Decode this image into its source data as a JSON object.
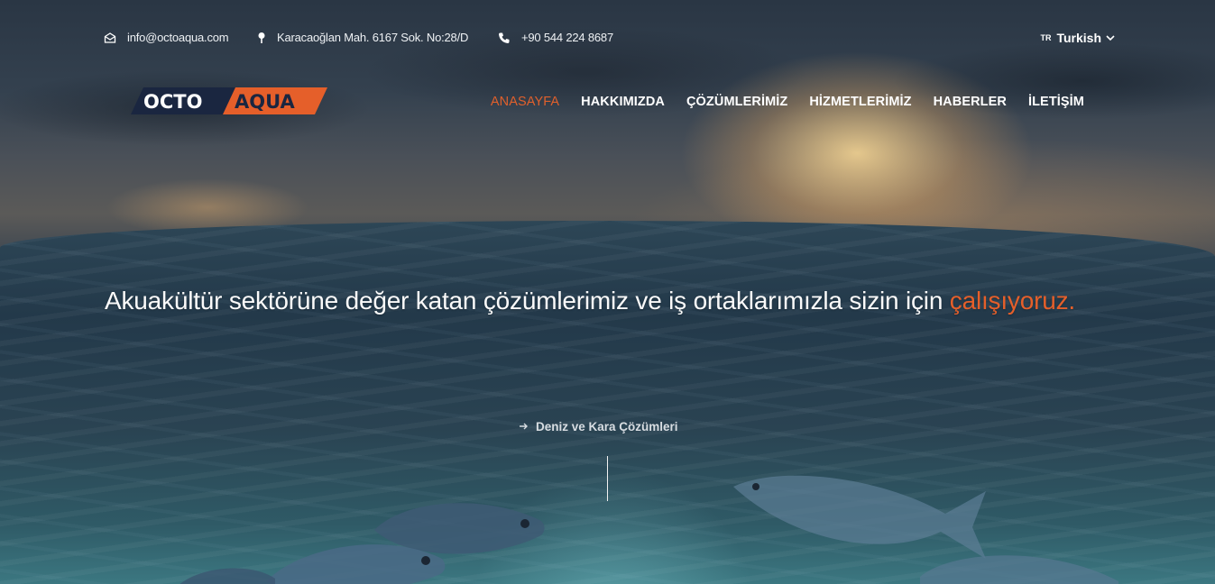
{
  "topbar": {
    "email": "info@octoaqua.com",
    "address": "Karacaoğlan Mah. 6167 Sok. No:28/D",
    "phone": "+90 544 224 8687",
    "language_code": "TR",
    "language_label": "Turkish"
  },
  "logo": {
    "part1": "OCTO",
    "part2": "AQUA",
    "colors": {
      "dark": "#1a2640",
      "accent": "#e55f2a"
    }
  },
  "nav": {
    "items": [
      {
        "label": "ANASAYFA",
        "active": true
      },
      {
        "label": "HAKKIMIZDA",
        "active": false
      },
      {
        "label": "ÇÖZÜMLERİMİZ",
        "active": false
      },
      {
        "label": "HİZMETLERİMİZ",
        "active": false
      },
      {
        "label": "HABERLER",
        "active": false
      },
      {
        "label": "İLETİŞİM",
        "active": false
      }
    ]
  },
  "hero": {
    "headline_main": "Akuakültür sektörüne değer katan çözümlerimiz ve iş ortaklarımızla sizin için ",
    "headline_accent": "çalışıyoruz.",
    "sublink_label": "Deniz ve Kara Çözümleri"
  },
  "icons": {
    "email": "envelope-icon",
    "address": "map-pin-icon",
    "phone": "phone-icon",
    "language": "chevron-down-icon",
    "sublink": "arrow-right-icon"
  },
  "colors": {
    "accent": "#e55f2a",
    "text": "#ffffff"
  }
}
